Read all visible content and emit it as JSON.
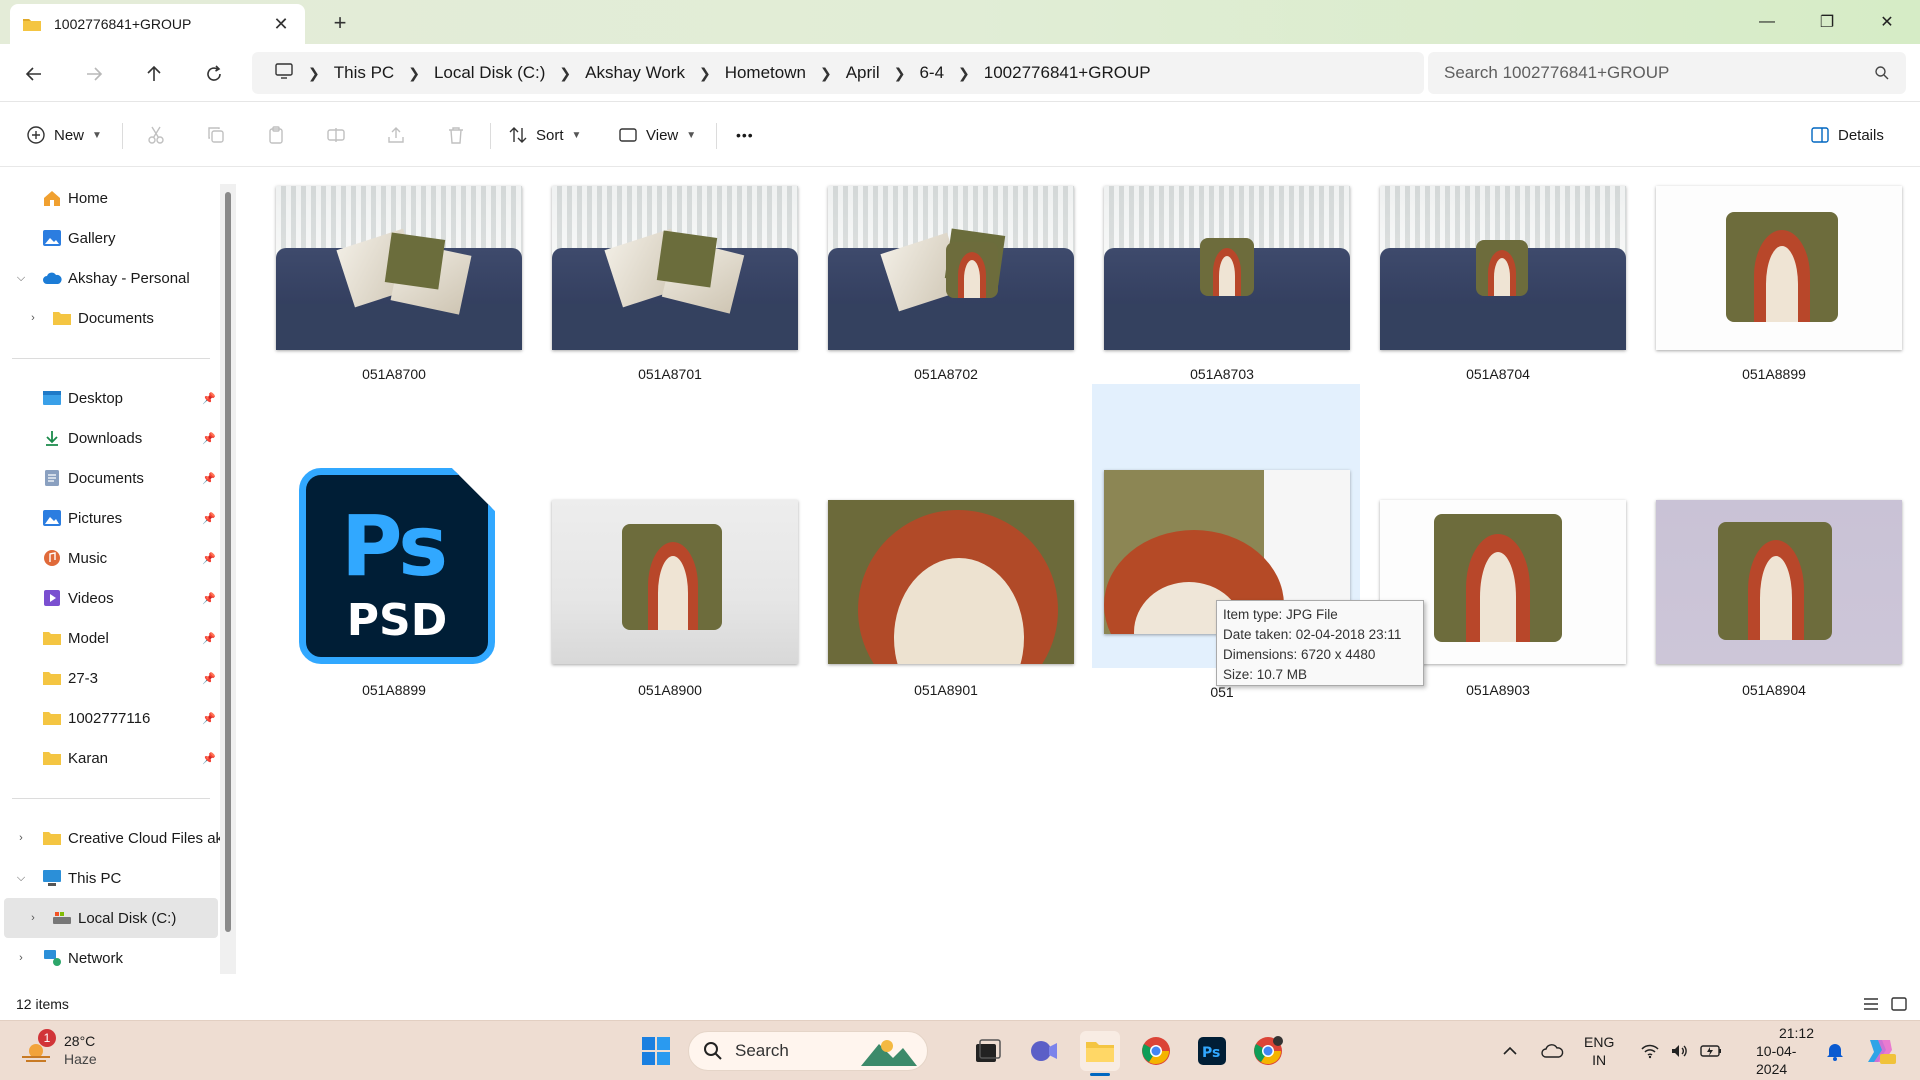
{
  "window": {
    "tab_title": "1002776841+GROUP",
    "new_tab": "+",
    "minimize": "—",
    "maximize": "❐",
    "close": "✕"
  },
  "address": {
    "breadcrumbs": [
      "This PC",
      "Local Disk (C:)",
      "Akshay Work",
      "Hometown",
      "April",
      "6-4",
      "1002776841+GROUP"
    ],
    "search_placeholder": "Search 1002776841+GROUP"
  },
  "toolbar": {
    "new_label": "New",
    "sort_label": "Sort",
    "view_label": "View",
    "more_label": "•••",
    "details_label": "Details"
  },
  "sidebar": {
    "quick": [
      {
        "label": "Home"
      },
      {
        "label": "Gallery"
      },
      {
        "label": "Akshay - Personal"
      },
      {
        "label": "Documents"
      }
    ],
    "pinned": [
      {
        "label": "Desktop"
      },
      {
        "label": "Downloads"
      },
      {
        "label": "Documents"
      },
      {
        "label": "Pictures"
      },
      {
        "label": "Music"
      },
      {
        "label": "Videos"
      },
      {
        "label": "Model"
      },
      {
        "label": "27-3"
      },
      {
        "label": "1002777116"
      },
      {
        "label": "Karan"
      }
    ],
    "bottom": [
      {
        "label": "Creative Cloud Files  ak"
      },
      {
        "label": "This PC"
      },
      {
        "label": "Local Disk (C:)"
      },
      {
        "label": "Network"
      }
    ]
  },
  "files": [
    {
      "name": "051A8700"
    },
    {
      "name": "051A8701"
    },
    {
      "name": "051A8702"
    },
    {
      "name": "051A8703"
    },
    {
      "name": "051A8704"
    },
    {
      "name": "051A8899"
    },
    {
      "name": "051A8899",
      "psd_text": "Ps",
      "psd_format": "PSD"
    },
    {
      "name": "051A8900"
    },
    {
      "name": "051A8901"
    },
    {
      "name": "051"
    },
    {
      "name": "051A8903"
    },
    {
      "name": "051A8904"
    }
  ],
  "tooltip": {
    "line1": "Item type: JPG File",
    "line2": "Date taken: 02-04-2018 23:11",
    "line3": "Dimensions: 6720 x 4480",
    "line4": "Size: 10.7 MB"
  },
  "status": {
    "item_count": "12 items"
  },
  "taskbar": {
    "weather_temp": "28°C",
    "weather_desc": "Haze",
    "weather_badge": "1",
    "search_label": "Search",
    "lang_top": "ENG",
    "lang_bottom": "IN",
    "time": "21:12",
    "date": "10-04-2024"
  },
  "colors": {
    "accent": "#0067c0",
    "selection": "#e3f0fd",
    "psd_blue": "#31a8ff",
    "psd_bg": "#001e36",
    "folder": "#f4c542"
  }
}
